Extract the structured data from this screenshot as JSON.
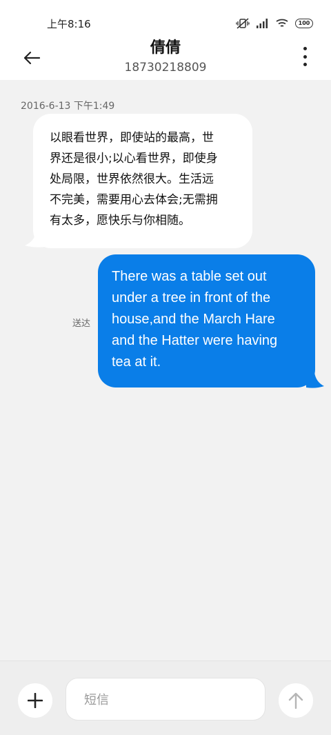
{
  "status_bar": {
    "time": "上午8:16",
    "battery": "100",
    "icons": [
      "mute-vibrate-icon",
      "signal-icon",
      "wifi-icon",
      "battery-icon"
    ]
  },
  "header": {
    "contact_name": "倩倩",
    "contact_number": "18730218809",
    "icons": [
      "back-arrow-icon",
      "more-vertical-icon"
    ]
  },
  "conversation": {
    "timestamp": "2016-6-13 下午1:49",
    "messages": [
      {
        "direction": "incoming",
        "lines": [
          "以眼看世界，即使站的最高，世",
          "界还是很小;以心看世界，即使身",
          "处局限，世界依然很大。生活远",
          "不完美，需要用心去体会;无需拥",
          "有太多，愿快乐与你相随。"
        ]
      },
      {
        "direction": "outgoing",
        "lines": [
          "There was a table set out",
          "under a tree in front of the",
          "house,and the March Hare",
          "and the Hatter were having",
          "tea at it."
        ],
        "status": "送达"
      }
    ]
  },
  "composer": {
    "placeholder": "短信",
    "icons": [
      "plus-icon",
      "send-arrow-icon"
    ]
  },
  "colors": {
    "outgoing_bubble": "#0a7ee8",
    "incoming_bubble": "#ffffff",
    "background": "#f2f2f2"
  }
}
